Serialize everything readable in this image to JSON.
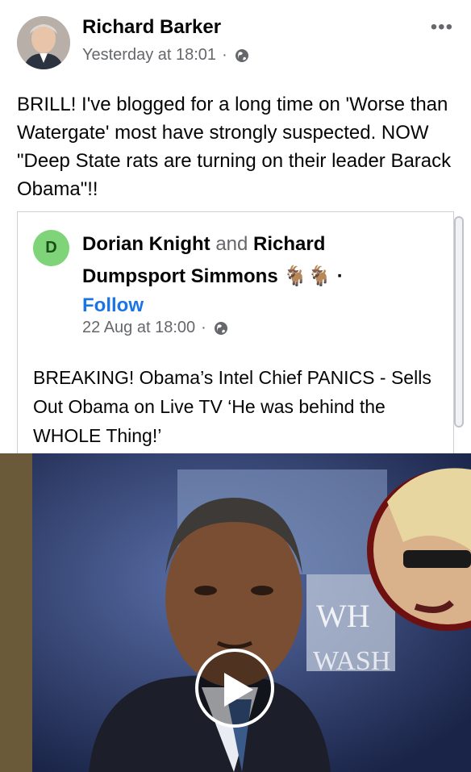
{
  "post": {
    "author": "Richard Barker",
    "timestamp": "Yesterday at 18:01",
    "separator": "·",
    "more": "•••",
    "text": "BRILL! I've blogged for a long time on 'Worse than Watergate' most have strongly suspected. NOW \"Deep State rats are turning on their leader Barack Obama\"!!",
    "privacy_icon": "globe-icon"
  },
  "shared": {
    "avatar_letter": "D",
    "author1": "Dorian Knight",
    "connector": "and",
    "author2": "Richard Dumpsport Simmons",
    "emoji": "🐐🐐",
    "separator": "·",
    "follow": "Follow",
    "timestamp": "22 Aug at 18:00",
    "text": "BREAKING! Obama’s Intel Chief PANICS - Sells Out Obama on Live TV ‘He was behind the WHOLE Thing!’"
  },
  "video": {
    "sign_text_1": "WH",
    "sign_text_2": "WASH",
    "play_icon": "play-icon"
  },
  "colors": {
    "link": "#1b74e4",
    "muted": "#65676b",
    "avatar_green": "#7fd47a"
  }
}
